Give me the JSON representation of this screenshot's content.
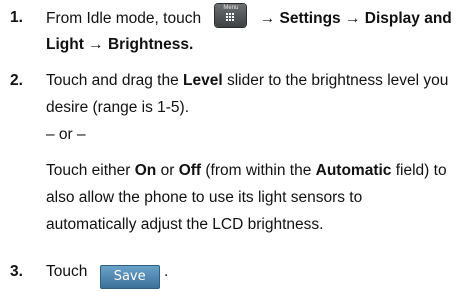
{
  "steps": [
    {
      "number": "1.",
      "line1_pre": "From Idle mode, touch",
      "menu_key_label": "Menu",
      "menu_key_icon": "menu-grid-icon",
      "line1_post": "→ Settings → Display and",
      "line2": "Light → Brightness."
    },
    {
      "number": "2.",
      "l1_a": "Touch and drag the ",
      "l1_b": "Level",
      "l1_c": " slider to the brightness level you",
      "l2": "desire (range is 1-5).",
      "or": "– or –",
      "l4_a": "Touch either ",
      "l4_b": "On",
      "l4_c": " or ",
      "l4_d": "Off",
      "l4_e": " (from within the ",
      "l4_f": "Automatic",
      "l4_g": " field) to",
      "l5": "also allow the phone to use its light sensors to",
      "l6": "automatically adjust the LCD brightness."
    },
    {
      "number": "3.",
      "text": "Touch",
      "button_label": "Save"
    }
  ]
}
